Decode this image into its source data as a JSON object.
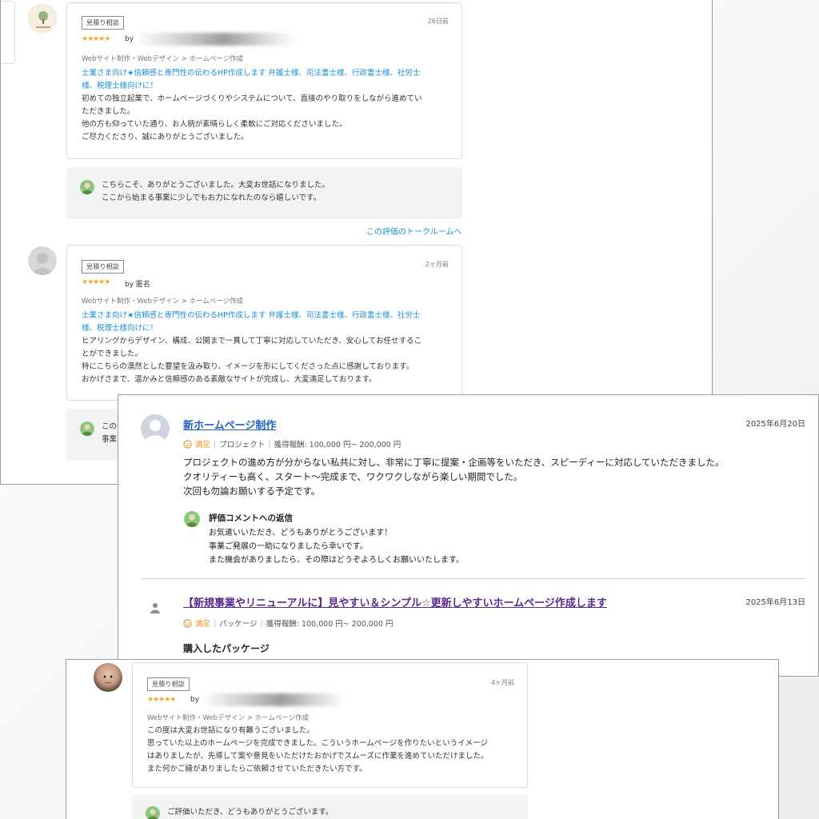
{
  "review1": {
    "badge": "見積り相談",
    "date": "26日前",
    "stars": "★★★★★",
    "by": "by",
    "category": "Webサイト制作・Webデザイン > ホームページ作成",
    "service_line1": "士業さま向け★信頼感と専門性の伝わるHP作成します 弁護士様、司法書士様、行政書士様、社労士",
    "service_line2": "様、税理士様向けに！",
    "body": "初めての独立起業で、ホームページづくりやシステムについて、直接のやり取りをしながら進めてい\nただきました。\n他の方も仰っていた通り、お人柄が素晴らしく柔軟にご対応くださいました。\nご尽力くださり、誠にありがとうございました。",
    "reply": "こちらこそ、ありがとうございました。大変お世話になりました。\nここから始まる事業に少しでもお力になれたのなら嬉しいです。",
    "talk_link": "この評価のトークルームへ"
  },
  "review2": {
    "badge": "見積り相談",
    "date": "2ヶ月前",
    "stars": "★★★★★",
    "by": "by 匿名",
    "category": "Webサイト制作・Webデザイン > ホームページ作成",
    "service_line1": "士業さま向け★信頼感と専門性の伝わるHP作成します 弁護士様、司法書士様、行政書士様、社労士",
    "service_line2": "様、税理士様向けに！",
    "body": "ヒアリングからデザイン、構成、公開まで一貫して丁寧に対応していただき、安心してお任せするこ\nとができました。\n特にこちらの漠然とした要望を汲み取り、イメージを形にしてくださった点に感謝しております。\nおかげさまで、温かみと信頼感のある素敵なサイトが完成し、大変満足しております。",
    "reply_partial": "この\n事業"
  },
  "panel2": {
    "entry1": {
      "title": "新ホームページ制作",
      "date": "2025年6月20日",
      "satisfaction": "満足",
      "type": "プロジェクト",
      "reward": "獲得報酬: 100,000 円~ 200,000 円",
      "body": "プロジェクトの進め方が分からない私共に対し、非常に丁寧に提案・企画等をいただき、スピーディーに対応していただきました。\nクオリティーも高く、スタート～完成まで、ワクワクしながら楽しい期間でした。\n次回も勿論お願いする予定です。",
      "reply_heading": "評価コメントへの返信",
      "reply": "お気遣いいただき、どうもありがとうございます！\n事業ご発展の一助になりましたら幸いです。\nまた機会がありましたら、その際はどうぞよろしくお願いいたします。"
    },
    "entry2": {
      "title": "【新規事業やリニューアルに】見やすい＆シンプル☆更新しやすいホームページ作成します",
      "date": "2025年6月13日",
      "satisfaction": "満足",
      "type": "パッケージ",
      "reward": "獲得報酬: 100,000 円~ 200,000 円",
      "section": "購入したパッケージ"
    }
  },
  "review3": {
    "badge": "見積り相談",
    "date": "4ヶ月前",
    "stars": "★★★★★",
    "by": "by",
    "category": "Webサイト制作・Webデザイン > ホームページ作成",
    "body": "この度は大変お世話になり有難うございました。\n思っていた以上のホームページを完成できました。こういうホームページを作りたいというイメージ\nはありましたが、先導して案や意見をいただけたおかげでスムーズに作業を進めていただけました。\nまた何かご縁がありましたらご依頼させていただきたい方です。",
    "reply": "ご評価いただき、どうもありがとうございます。"
  },
  "colors": {
    "link": "#1a8fd6",
    "star": "#f5a623",
    "satisfaction": "#f08c1c",
    "title_blue": "#1f5fbf",
    "title_purple": "#5a2a8a"
  }
}
